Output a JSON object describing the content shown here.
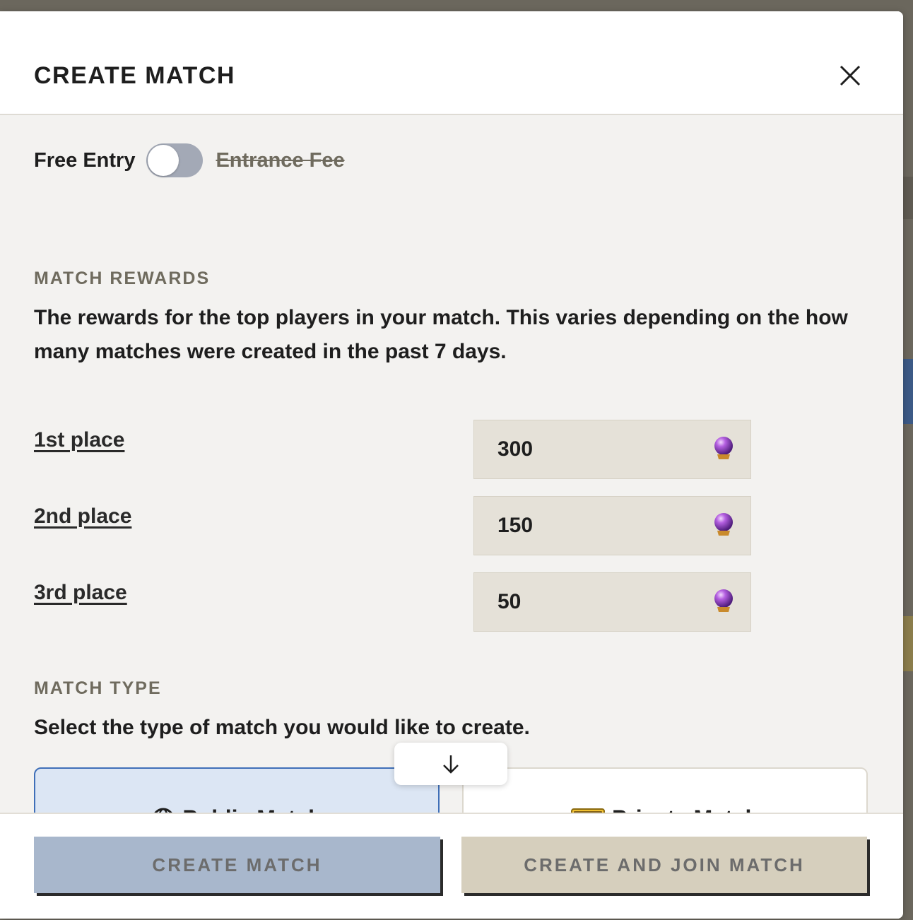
{
  "modal": {
    "title": "CREATE MATCH",
    "close_icon": "close-icon"
  },
  "entry": {
    "free_label": "Free Entry",
    "fee_label": "Entrance Fee",
    "toggle_state": "off"
  },
  "rewards": {
    "heading": "MATCH REWARDS",
    "description": "The rewards for the top players in your match. This varies depending on the how many matches were created in the past 7 days.",
    "currency_icon": "crystal-ball-icon",
    "places": [
      {
        "label": "1st place",
        "value": "300"
      },
      {
        "label": "2nd place",
        "value": "150"
      },
      {
        "label": "3rd place",
        "value": "50"
      }
    ]
  },
  "match_type": {
    "heading": "MATCH TYPE",
    "description": "Select the type of match you would like to create.",
    "options": [
      {
        "label": "Public Match",
        "icon": "globe-icon",
        "selected": true
      },
      {
        "label": "Private Match",
        "icon": "pass-icon",
        "selected": false
      }
    ],
    "scroll_icon": "arrow-down-icon"
  },
  "footer": {
    "create_label": "CREATE MATCH",
    "create_join_label": "CREATE AND JOIN MATCH"
  },
  "colors": {
    "selected_border": "#3f6fb8",
    "selected_fill": "#dce6f4",
    "field_fill": "#e5e1d8",
    "create_btn": "#a8b7cc",
    "join_btn": "#d6cfbd"
  }
}
